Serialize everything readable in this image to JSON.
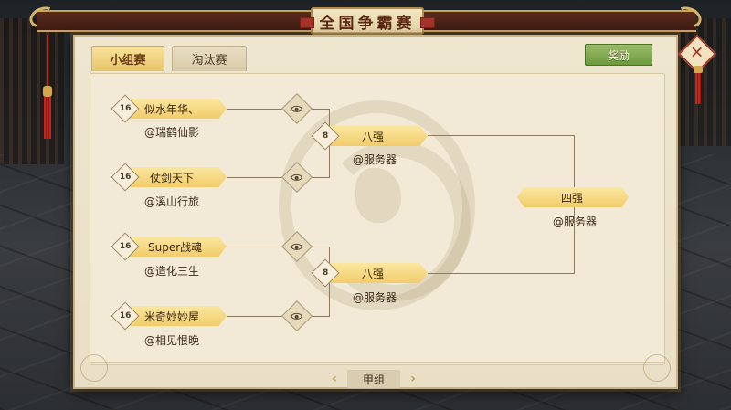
{
  "title": "全国争霸赛",
  "tabs": [
    {
      "label": "小组赛",
      "active": true
    },
    {
      "label": "淘汰赛",
      "active": false
    }
  ],
  "reward_button": "奖励",
  "close_icon": "close-x-icon",
  "round_of_16": [
    {
      "seed": "16",
      "name": "似水年华、",
      "server": "@瑞鹤仙影"
    },
    {
      "seed": "16",
      "name": "仗剑天下",
      "server": "@溪山行旅"
    },
    {
      "seed": "16",
      "name": "Super战魂",
      "server": "@造化三生"
    },
    {
      "seed": "16",
      "name": "米奇妙妙屋",
      "server": "@相见恨晚"
    }
  ],
  "round_of_8": [
    {
      "seed": "8",
      "name": "八强",
      "server": "@服务器"
    },
    {
      "seed": "8",
      "name": "八强",
      "server": "@服务器"
    }
  ],
  "round_of_4": {
    "name": "四强",
    "server": "@服务器"
  },
  "group_nav": {
    "label": "甲组",
    "prev": "‹",
    "next": "›"
  },
  "colors": {
    "ribbon": "#f1cc6a",
    "panel": "#efe6d0",
    "reward_green": "#6c9a3e",
    "header": "#5a2a1c"
  }
}
